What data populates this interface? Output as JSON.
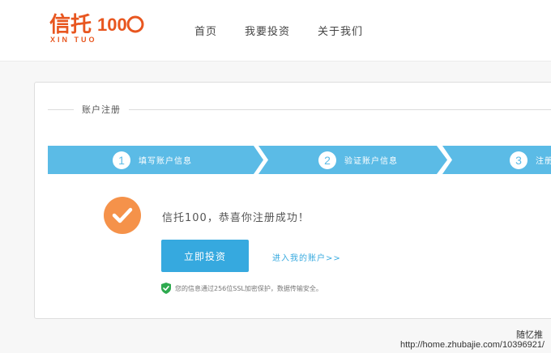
{
  "header": {
    "logo": {
      "main": "信托",
      "num": "100",
      "sub": "XIN TUO"
    },
    "nav": [
      "首页",
      "我要投资",
      "关于我们"
    ]
  },
  "section": {
    "title": "账户注册"
  },
  "steps": [
    {
      "num": "1",
      "label": "填写账户信息"
    },
    {
      "num": "2",
      "label": "验证账户信息"
    },
    {
      "num": "3",
      "label": "注册"
    }
  ],
  "success": {
    "message": "信托100，恭喜你注册成功！",
    "invest_button": "立即投资",
    "account_link": "进入我的账户>>",
    "notice": "您的信息通过256位SSL加密保护，数据传输安全。"
  },
  "watermark": {
    "name": "随忆推",
    "url": "http://home.zhubajie.com/10396921/"
  },
  "colors": {
    "accent": "#36a9df",
    "step_bar": "#5bbbe6",
    "success": "#f5924a",
    "logo": "#e8561f"
  }
}
